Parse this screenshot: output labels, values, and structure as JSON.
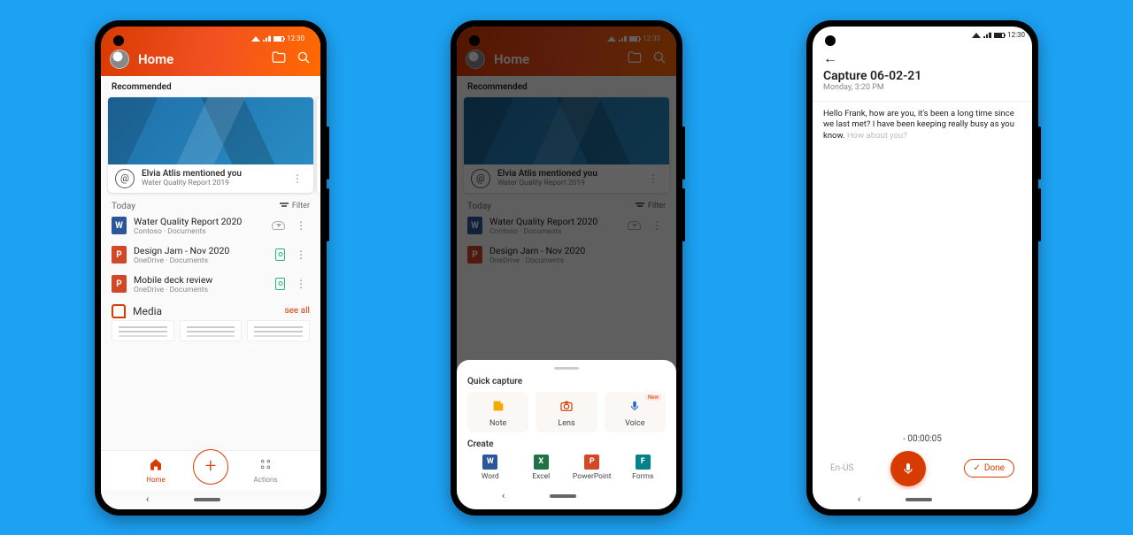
{
  "status": {
    "time": "12:30"
  },
  "phone1": {
    "header": {
      "title": "Home"
    },
    "recommended": {
      "label": "Recommended",
      "mention_title": "Elvia Atlis mentioned you",
      "mention_sub": "Water Quality Report 2019"
    },
    "today": {
      "label": "Today",
      "filter": "Filter"
    },
    "files": [
      {
        "name": "Water Quality Report 2020",
        "meta": "Contoso · Documents",
        "type": "word",
        "badge": "cloud"
      },
      {
        "name": "Design Jam - Nov 2020",
        "meta": "OneDrive · Documents",
        "type": "ppt",
        "badge": "pin"
      },
      {
        "name": "Mobile deck review",
        "meta": "OneDrive · Documents",
        "type": "ppt",
        "badge": "pin"
      }
    ],
    "media": {
      "label": "Media",
      "see_all": "see all"
    },
    "tabs": {
      "home": "Home",
      "actions": "Actions"
    }
  },
  "phone2": {
    "sheet": {
      "quick_label": "Quick capture",
      "create_label": "Create",
      "qc": {
        "note": "Note",
        "lens": "Lens",
        "voice": "Voice",
        "voice_badge": "New"
      },
      "create": {
        "word": "Word",
        "excel": "Excel",
        "ppt": "PowerPoint",
        "forms": "Forms"
      }
    }
  },
  "phone3": {
    "title": "Capture 06-02-21",
    "subtitle": "Monday, 3:20 PM",
    "transcript_main": "Hello Frank, how are you, it's been a long time since we last met? I have been keeping really busy as you know. ",
    "transcript_ghost": "How about you?",
    "timer": "- 00:00:05",
    "lang": "En-US",
    "done": "Done"
  }
}
